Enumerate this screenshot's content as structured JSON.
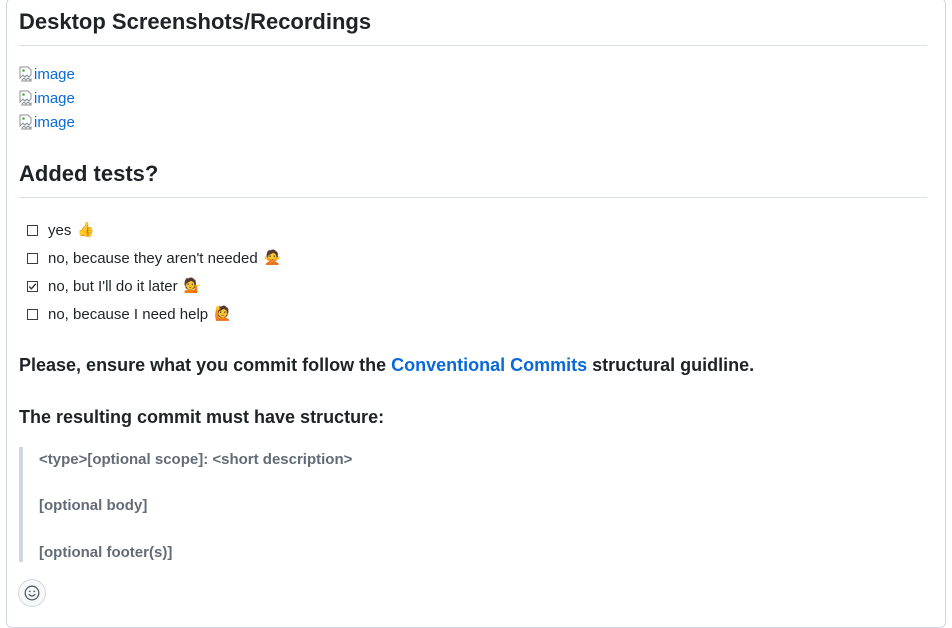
{
  "headings": {
    "desktop": "Desktop Screenshots/Recordings",
    "tests": "Added tests?"
  },
  "images": [
    {
      "alt": "image"
    },
    {
      "alt": "image"
    },
    {
      "alt": "image"
    }
  ],
  "tasks": [
    {
      "label": "yes",
      "checked": false,
      "emoji": "👍",
      "icon": "thumbs-up-icon"
    },
    {
      "label": "no, because they aren't needed",
      "checked": false,
      "emoji": "🙅",
      "icon": "person-gesturing-no-icon"
    },
    {
      "label": "no, but I'll do it later",
      "checked": true,
      "emoji": "💁",
      "icon": "person-tipping-hand-icon"
    },
    {
      "label": "no, because I need help",
      "checked": false,
      "emoji": "🙋",
      "icon": "person-raising-hand-icon"
    }
  ],
  "ensure": {
    "before": "Please, ensure what you commit follow the ",
    "link": "Conventional Commits",
    "after": " structural guidline."
  },
  "structure_heading": "The resulting commit must have structure:",
  "quote": {
    "line1": "<type>[optional scope]: <short description>",
    "line2": "[optional body]",
    "line3": "[optional footer(s)]"
  },
  "colors": {
    "link": "#0969da",
    "text": "#1f2328",
    "muted": "#636c76",
    "border": "#d0d7de"
  }
}
